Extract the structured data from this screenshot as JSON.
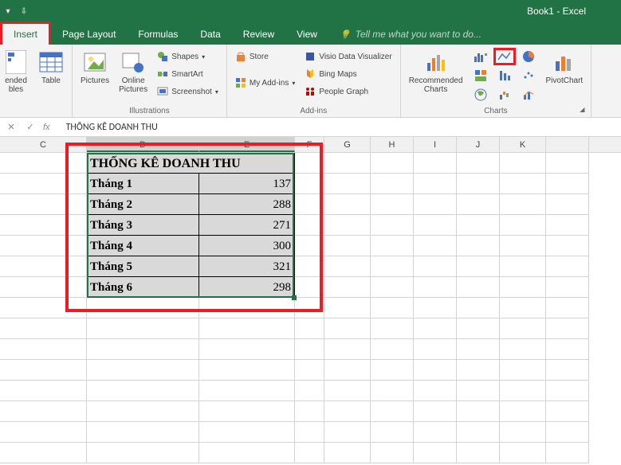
{
  "app_title": "Book1 - Excel",
  "tabs": {
    "insert": "Insert",
    "page_layout": "Page Layout",
    "formulas": "Formulas",
    "data": "Data",
    "review": "Review",
    "view": "View",
    "tell_me": "Tell me what you want to do..."
  },
  "ribbon": {
    "tables": {
      "recommended": "ended\nbles",
      "table": "Table",
      "label": ""
    },
    "illustrations": {
      "pictures": "Pictures",
      "online_pictures": "Online\nPictures",
      "shapes": "Shapes",
      "smartart": "SmartArt",
      "screenshot": "Screenshot",
      "label": "Illustrations"
    },
    "addins": {
      "store": "Store",
      "my_addins": "My Add-ins",
      "visio": "Visio Data Visualizer",
      "bing": "Bing Maps",
      "people": "People Graph",
      "label": "Add-ins"
    },
    "charts": {
      "recommended": "Recommended\nCharts",
      "pivot": "PivotChart",
      "label": "Charts"
    }
  },
  "formula_bar": {
    "value": "THỐNG KÊ DOANH THU"
  },
  "columns": [
    "C",
    "D",
    "E",
    "F",
    "G",
    "H",
    "I",
    "J",
    "K"
  ],
  "data": {
    "title": "THỐNG KÊ DOANH THU",
    "rows": [
      {
        "label": "Tháng 1",
        "value": "137"
      },
      {
        "label": "Tháng 2",
        "value": "288"
      },
      {
        "label": "Tháng 3",
        "value": "271"
      },
      {
        "label": "Tháng 4",
        "value": "300"
      },
      {
        "label": "Tháng 5",
        "value": "321"
      },
      {
        "label": "Tháng 6",
        "value": "298"
      }
    ]
  }
}
